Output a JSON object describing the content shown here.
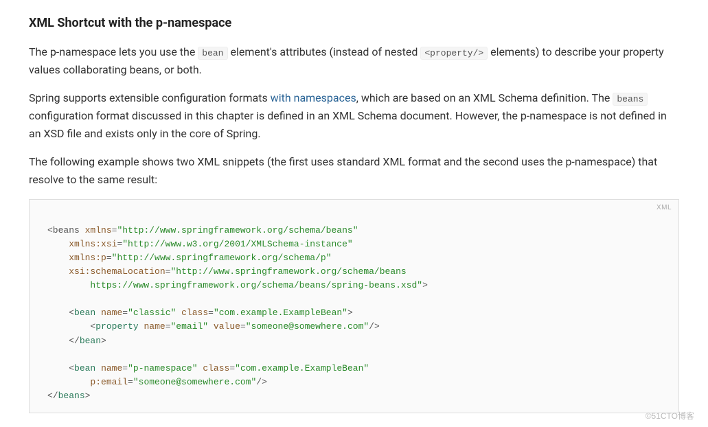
{
  "heading": "XML Shortcut with the p-namespace",
  "para1": {
    "t1": "The p-namespace lets you use the ",
    "code1": "bean",
    "t2": " element's attributes (instead of nested ",
    "code2": "<property/>",
    "t3": " elements) to describe your property values collaborating beans, or both."
  },
  "para2": {
    "t1": "Spring supports extensible configuration formats ",
    "link_text": "with namespaces",
    "t2": ", which are based on an XML Schema definition. The ",
    "code1": "beans",
    "t3": " configuration format discussed in this chapter is defined in an XML Schema document. However, the p-namespace is not defined in an XSD file and exists only in the core of Spring."
  },
  "para3": "The following example shows two XML snippets (the first uses standard XML format and the second uses the p-namespace) that resolve to the same result:",
  "code_lang": "XML",
  "code": {
    "l1_p1": "<beans ",
    "l1_a1": "xmlns",
    "l1_eq": "=",
    "l1_s1": "\"http://www.springframework.org/schema/beans\"",
    "l2_a1": "xmlns:xsi",
    "l2_s1": "\"http://www.w3.org/2001/XMLSchema-instance\"",
    "l3_a1": "xmlns:p",
    "l3_s1": "\"http://www.springframework.org/schema/p\"",
    "l4_a1": "xsi:schemaLocation",
    "l4_s1": "\"http://www.springframework.org/schema/beans",
    "l5_s1": "https://www.springframework.org/schema/beans/spring-beans.xsd\"",
    "l5_p2": ">",
    "l6_t1": "bean",
    "l6_a1": "name",
    "l6_s1": "\"classic\"",
    "l6_a2": "class",
    "l6_s2": "\"com.example.ExampleBean\"",
    "l7_t1": "property",
    "l7_a1": "name",
    "l7_s1": "\"email\"",
    "l7_a2": "value",
    "l7_s2": "\"someone@somewhere.com\"",
    "l8_t1": "bean",
    "l9_t1": "bean",
    "l9_a1": "name",
    "l9_s1": "\"p-namespace\"",
    "l9_a2": "class",
    "l9_s2": "\"com.example.ExampleBean\"",
    "l10_a1": "p:email",
    "l10_s1": "\"someone@somewhere.com\"",
    "l11_t1": "beans"
  },
  "watermark": "©51CTO博客"
}
